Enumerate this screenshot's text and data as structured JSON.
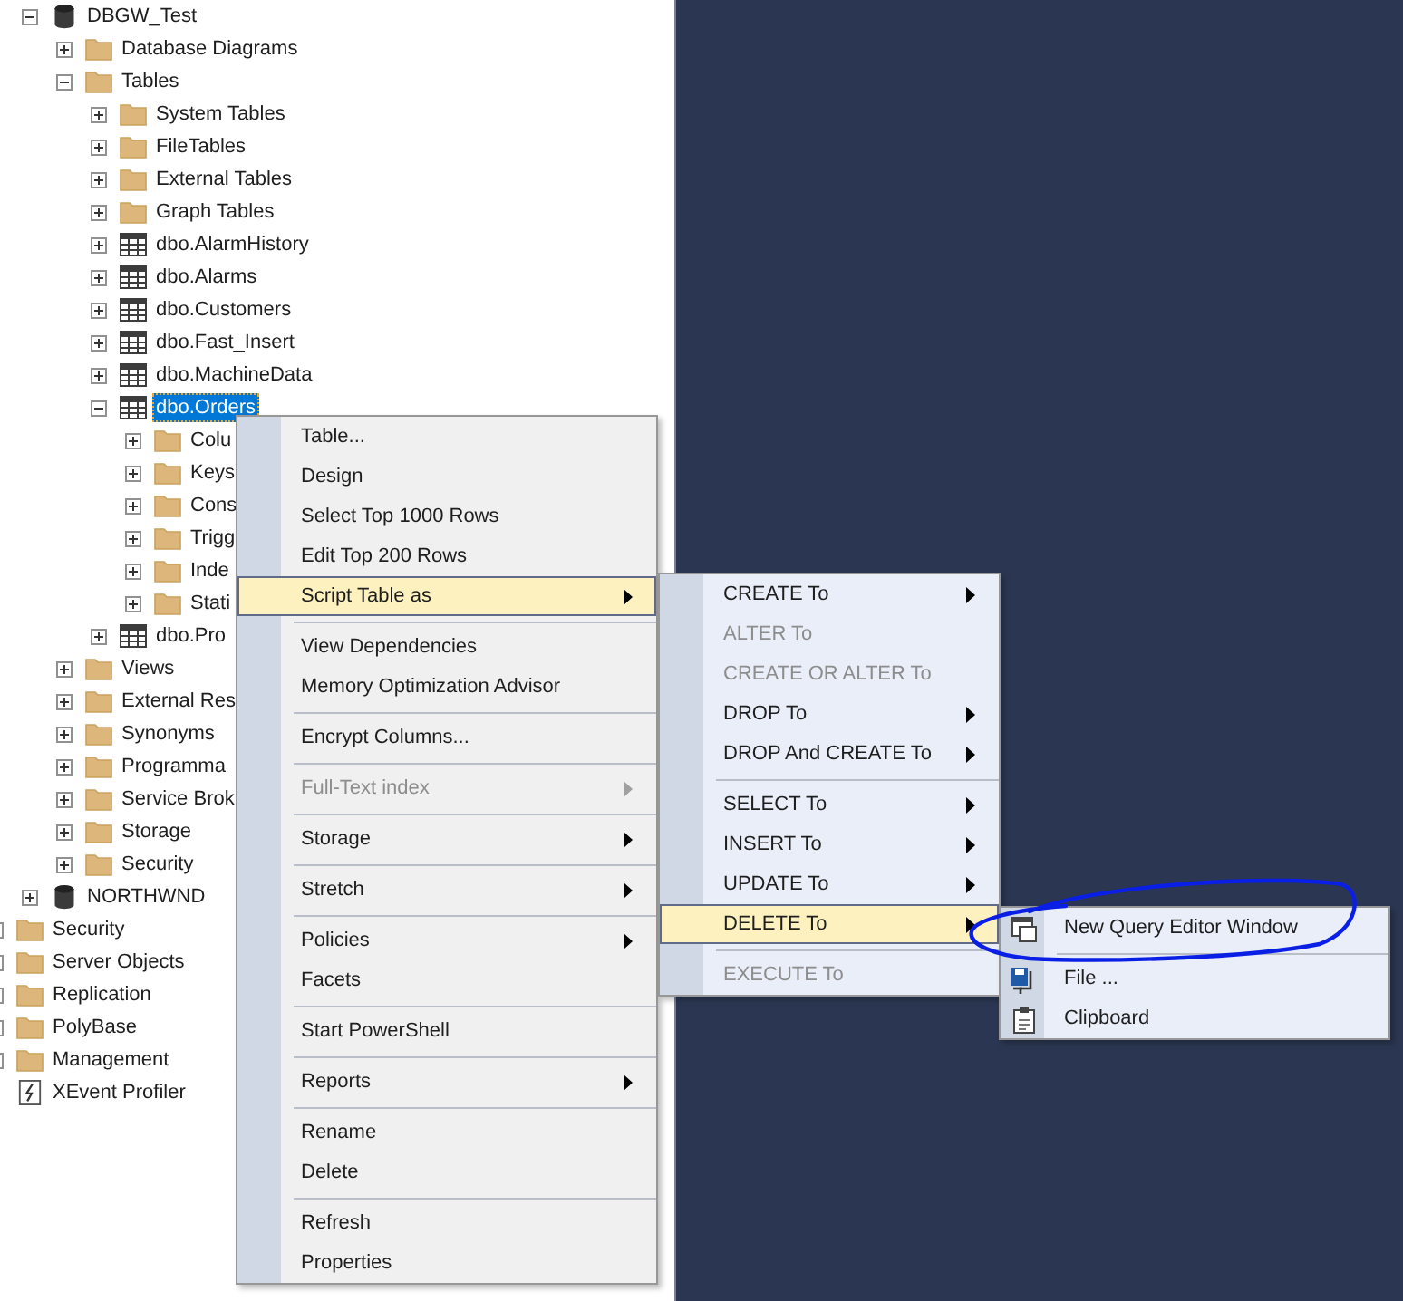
{
  "tree": {
    "database_nodes": [
      {
        "label": "DBGW_Test",
        "kind": "database",
        "expanded": true,
        "selected": false,
        "children": [
          {
            "label": "Database Diagrams",
            "kind": "folder",
            "expanded": false,
            "selected": false
          },
          {
            "label": "Tables",
            "kind": "folder",
            "expanded": true,
            "selected": false,
            "children": [
              {
                "label": "System Tables",
                "kind": "folder",
                "expanded": false,
                "selected": false
              },
              {
                "label": "FileTables",
                "kind": "folder",
                "expanded": false,
                "selected": false
              },
              {
                "label": "External Tables",
                "kind": "folder",
                "expanded": false,
                "selected": false
              },
              {
                "label": "Graph Tables",
                "kind": "folder",
                "expanded": false,
                "selected": false
              },
              {
                "label": "dbo.AlarmHistory",
                "kind": "table",
                "expanded": false,
                "selected": false
              },
              {
                "label": "dbo.Alarms",
                "kind": "table",
                "expanded": false,
                "selected": false
              },
              {
                "label": "dbo.Customers",
                "kind": "table",
                "expanded": false,
                "selected": false
              },
              {
                "label": "dbo.Fast_Insert",
                "kind": "table",
                "expanded": false,
                "selected": false
              },
              {
                "label": "dbo.MachineData",
                "kind": "table",
                "expanded": false,
                "selected": false
              },
              {
                "label": "dbo.Orders",
                "kind": "table",
                "expanded": true,
                "selected": true,
                "children": [
                  {
                    "label": "Colu",
                    "kind": "folder",
                    "expanded": false,
                    "selected": false
                  },
                  {
                    "label": "Keys",
                    "kind": "folder",
                    "expanded": false,
                    "selected": false
                  },
                  {
                    "label": "Cons",
                    "kind": "folder",
                    "expanded": false,
                    "selected": false
                  },
                  {
                    "label": "Trigg",
                    "kind": "folder",
                    "expanded": false,
                    "selected": false
                  },
                  {
                    "label": "Inde",
                    "kind": "folder",
                    "expanded": false,
                    "selected": false
                  },
                  {
                    "label": "Stati",
                    "kind": "folder",
                    "expanded": false,
                    "selected": false
                  }
                ]
              },
              {
                "label": "dbo.Pro",
                "kind": "table",
                "expanded": false,
                "selected": false
              }
            ]
          },
          {
            "label": "Views",
            "kind": "folder",
            "expanded": false,
            "selected": false
          },
          {
            "label": "External Res",
            "kind": "folder",
            "expanded": false,
            "selected": false
          },
          {
            "label": "Synonyms",
            "kind": "folder",
            "expanded": false,
            "selected": false
          },
          {
            "label": "Programma",
            "kind": "folder",
            "expanded": false,
            "selected": false
          },
          {
            "label": "Service Brok",
            "kind": "folder",
            "expanded": false,
            "selected": false
          },
          {
            "label": "Storage",
            "kind": "folder",
            "expanded": false,
            "selected": false
          },
          {
            "label": "Security",
            "kind": "folder",
            "expanded": false,
            "selected": false
          }
        ]
      },
      {
        "label": "NORTHWND",
        "kind": "database",
        "expanded": false,
        "selected": false
      }
    ],
    "server_nodes": [
      {
        "label": "Security",
        "kind": "folder",
        "expandable": true,
        "selected": false
      },
      {
        "label": "Server Objects",
        "kind": "folder",
        "expandable": true,
        "selected": false
      },
      {
        "label": "Replication",
        "kind": "folder",
        "expandable": true,
        "selected": false
      },
      {
        "label": "PolyBase",
        "kind": "folder",
        "expandable": true,
        "selected": false
      },
      {
        "label": "Management",
        "kind": "folder",
        "expandable": true,
        "selected": false
      },
      {
        "label": "XEvent Profiler",
        "kind": "profiler",
        "expandable": false,
        "selected": false
      }
    ]
  },
  "context_menu": {
    "items": [
      {
        "kind": "item",
        "label": "Table...",
        "submenu": false,
        "disabled": false,
        "selected": false
      },
      {
        "kind": "item",
        "label": "Design",
        "submenu": false,
        "disabled": false,
        "selected": false
      },
      {
        "kind": "item",
        "label": "Select Top 1000 Rows",
        "submenu": false,
        "disabled": false,
        "selected": false
      },
      {
        "kind": "item",
        "label": "Edit Top 200 Rows",
        "submenu": false,
        "disabled": false,
        "selected": false
      },
      {
        "kind": "item",
        "label": "Script Table as",
        "submenu": true,
        "disabled": false,
        "selected": true
      },
      {
        "kind": "separator"
      },
      {
        "kind": "item",
        "label": "View Dependencies",
        "submenu": false,
        "disabled": false,
        "selected": false
      },
      {
        "kind": "item",
        "label": "Memory Optimization Advisor",
        "submenu": false,
        "disabled": false,
        "selected": false
      },
      {
        "kind": "separator"
      },
      {
        "kind": "item",
        "label": "Encrypt Columns...",
        "submenu": false,
        "disabled": false,
        "selected": false
      },
      {
        "kind": "separator"
      },
      {
        "kind": "item",
        "label": "Full-Text index",
        "submenu": true,
        "disabled": true,
        "selected": false
      },
      {
        "kind": "separator"
      },
      {
        "kind": "item",
        "label": "Storage",
        "submenu": true,
        "disabled": false,
        "selected": false
      },
      {
        "kind": "separator"
      },
      {
        "kind": "item",
        "label": "Stretch",
        "submenu": true,
        "disabled": false,
        "selected": false
      },
      {
        "kind": "separator"
      },
      {
        "kind": "item",
        "label": "Policies",
        "submenu": true,
        "disabled": false,
        "selected": false
      },
      {
        "kind": "item",
        "label": "Facets",
        "submenu": false,
        "disabled": false,
        "selected": false
      },
      {
        "kind": "separator"
      },
      {
        "kind": "item",
        "label": "Start PowerShell",
        "submenu": false,
        "disabled": false,
        "selected": false
      },
      {
        "kind": "separator"
      },
      {
        "kind": "item",
        "label": "Reports",
        "submenu": true,
        "disabled": false,
        "selected": false
      },
      {
        "kind": "separator"
      },
      {
        "kind": "item",
        "label": "Rename",
        "submenu": false,
        "disabled": false,
        "selected": false
      },
      {
        "kind": "item",
        "label": "Delete",
        "submenu": false,
        "disabled": false,
        "selected": false
      },
      {
        "kind": "separator"
      },
      {
        "kind": "item",
        "label": "Refresh",
        "submenu": false,
        "disabled": false,
        "selected": false
      },
      {
        "kind": "item",
        "label": "Properties",
        "submenu": false,
        "disabled": false,
        "selected": false
      }
    ]
  },
  "script_submenu": {
    "items": [
      {
        "kind": "item",
        "label": "CREATE To",
        "submenu": true,
        "disabled": false,
        "selected": false
      },
      {
        "kind": "item",
        "label": "ALTER To",
        "submenu": false,
        "disabled": true,
        "selected": false
      },
      {
        "kind": "item",
        "label": "CREATE OR ALTER To",
        "submenu": false,
        "disabled": true,
        "selected": false
      },
      {
        "kind": "item",
        "label": "DROP To",
        "submenu": true,
        "disabled": false,
        "selected": false
      },
      {
        "kind": "item",
        "label": "DROP And CREATE To",
        "submenu": true,
        "disabled": false,
        "selected": false
      },
      {
        "kind": "separator"
      },
      {
        "kind": "item",
        "label": "SELECT To",
        "submenu": true,
        "disabled": false,
        "selected": false
      },
      {
        "kind": "item",
        "label": "INSERT To",
        "submenu": true,
        "disabled": false,
        "selected": false
      },
      {
        "kind": "item",
        "label": "UPDATE To",
        "submenu": true,
        "disabled": false,
        "selected": false
      },
      {
        "kind": "item",
        "label": "DELETE To",
        "submenu": true,
        "disabled": false,
        "selected": true
      },
      {
        "kind": "separator"
      },
      {
        "kind": "item",
        "label": "EXECUTE To",
        "submenu": false,
        "disabled": true,
        "selected": false
      }
    ]
  },
  "delete_submenu": {
    "items": [
      {
        "kind": "window_item",
        "label": "New Query Editor Window",
        "disabled": false,
        "selected": false
      },
      {
        "kind": "separator"
      },
      {
        "kind": "file_item",
        "label": "File ...",
        "disabled": false,
        "selected": false
      },
      {
        "kind": "clipboard_item",
        "label": "Clipboard",
        "disabled": false,
        "selected": false
      }
    ]
  }
}
